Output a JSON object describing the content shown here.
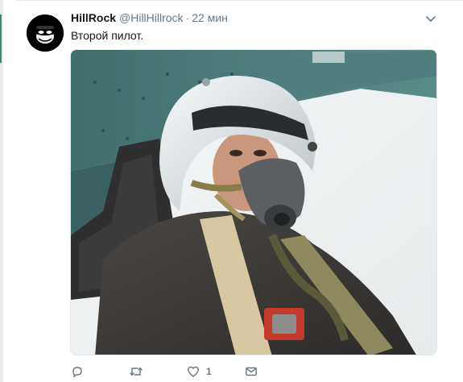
{
  "tweet": {
    "author": {
      "display_name": "HillRock",
      "handle": "@HillHillrock"
    },
    "separator": "·",
    "timestamp": "22 мин",
    "text": "Второй пилот.",
    "media": {
      "alt": "pilot-selfie-photo"
    },
    "actions": {
      "reply_count": "",
      "retweet_count": "",
      "like_count": "1"
    }
  },
  "colors": {
    "text_primary": "#14171a",
    "text_secondary": "#657786",
    "border": "#e1e8ed",
    "accent_edge": "#3e8e63"
  }
}
